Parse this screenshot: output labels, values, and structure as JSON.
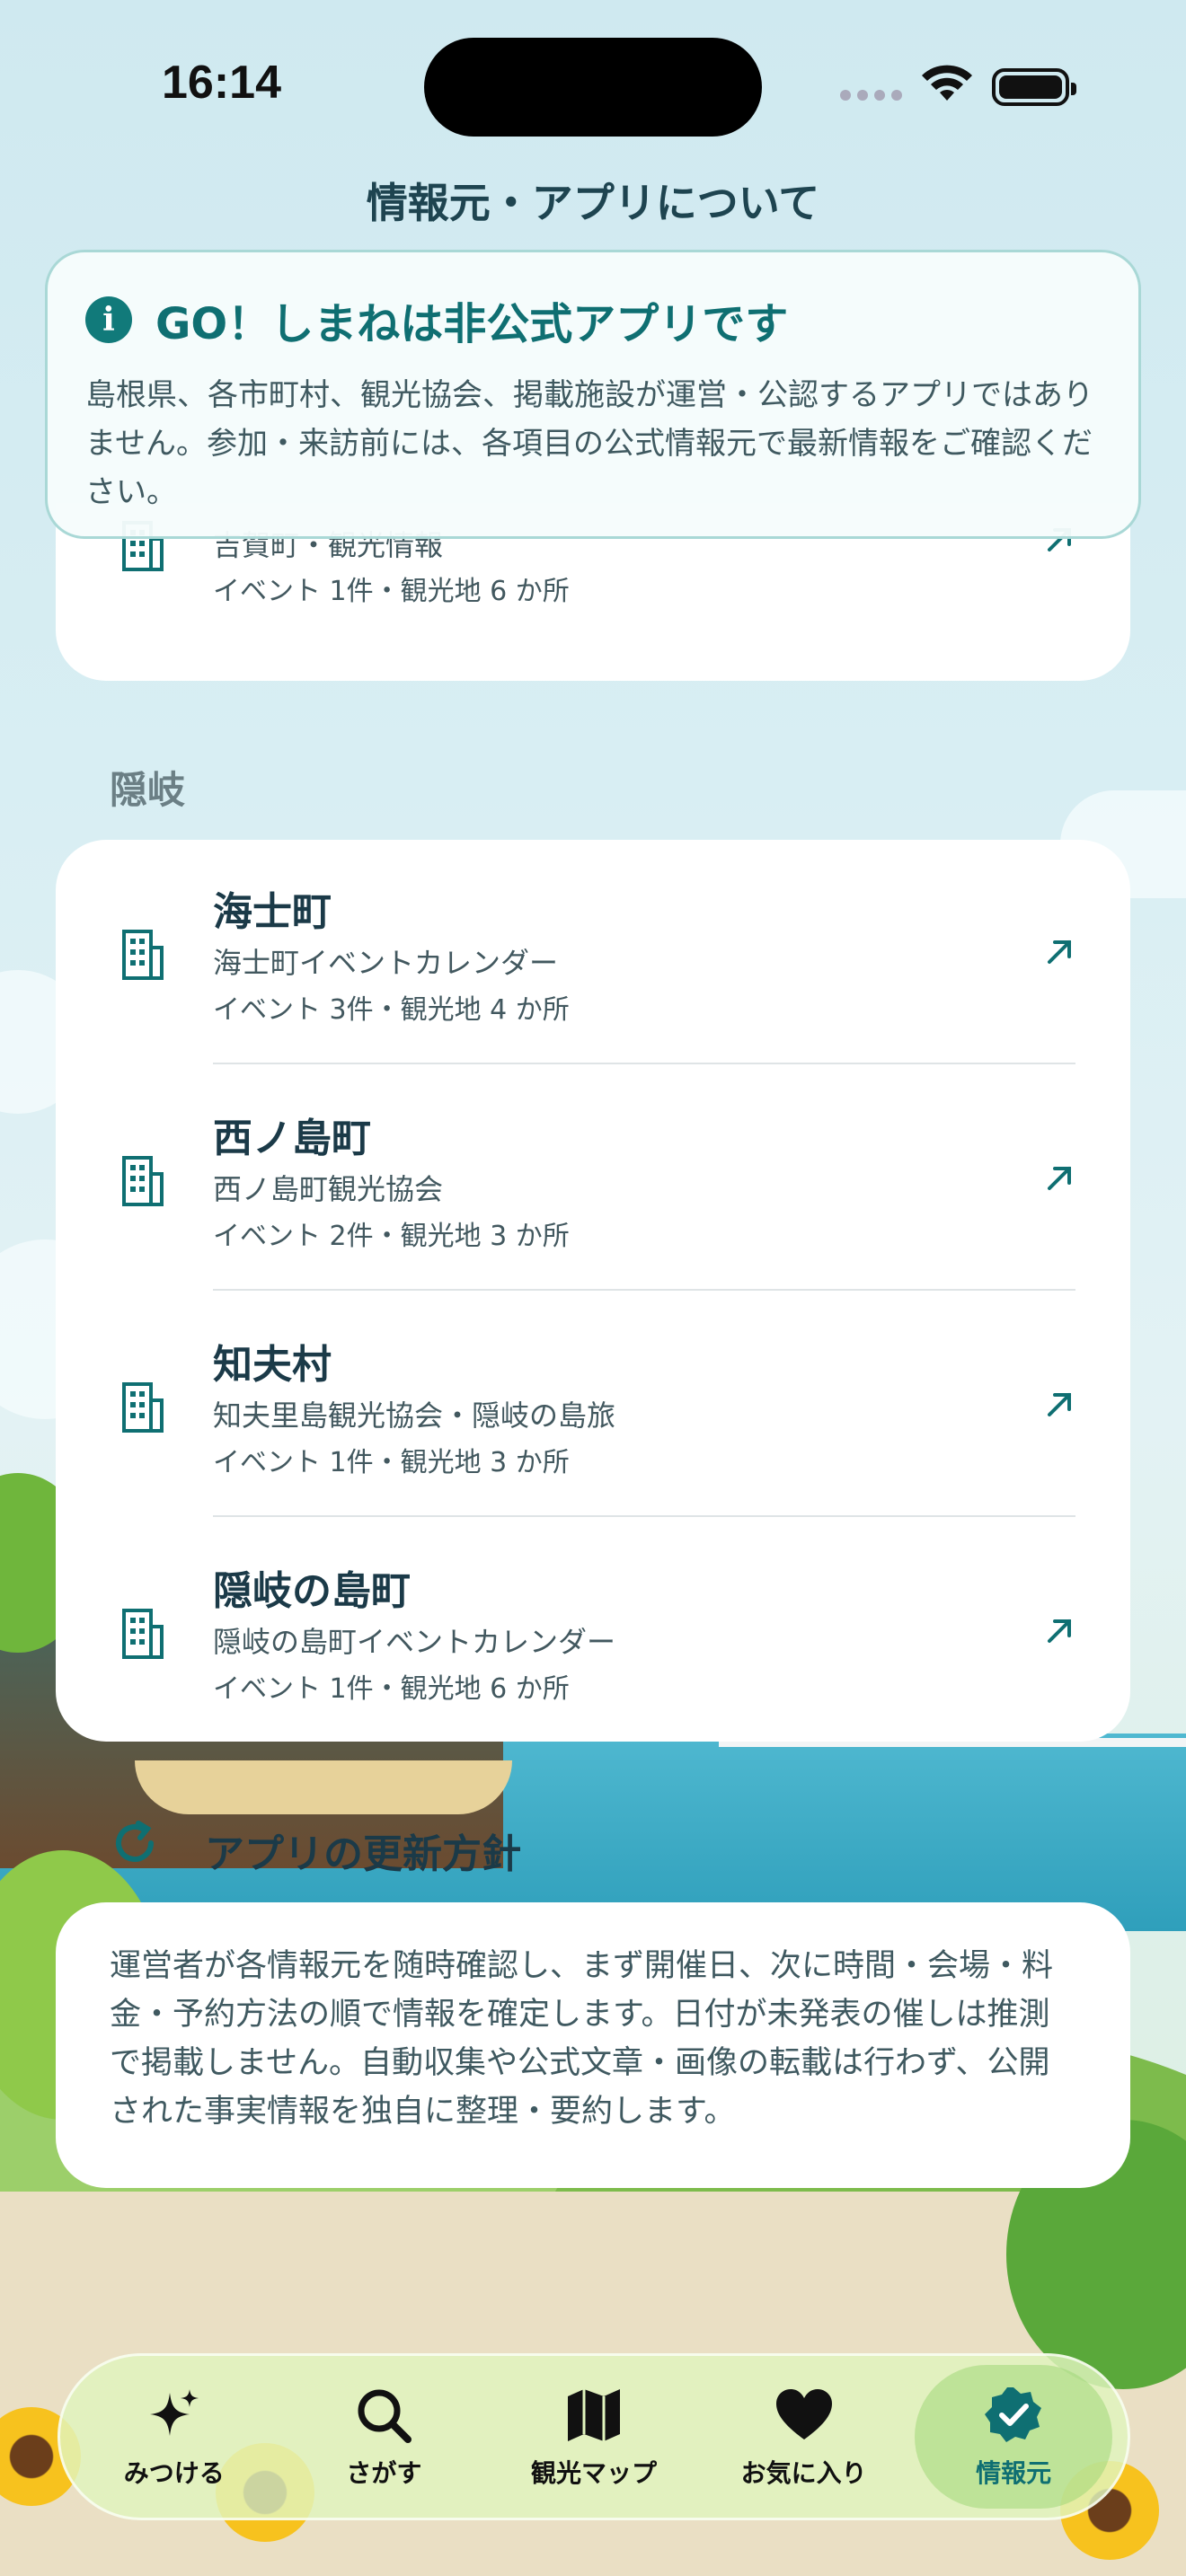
{
  "status_bar": {
    "time": "16:14"
  },
  "page_title": "情報元・アプリについて",
  "notice": {
    "title": "GO！しまねは非公式アプリです",
    "body": "島根県、各市町村、観光協会、掲載施設が運営・公認するアプリではありません。参加・来訪前には、各項目の公式情報元で最新情報をご確認ください。"
  },
  "partial_row": {
    "sub": "吉賀町・観光情報",
    "meta": "イベント 1件・観光地 6 か所"
  },
  "oki": {
    "label": "隠岐",
    "rows": [
      {
        "name": "海士町",
        "sub": "海士町イベントカレンダー",
        "meta": "イベント 3件・観光地 4 か所"
      },
      {
        "name": "西ノ島町",
        "sub": "西ノ島町観光協会",
        "meta": "イベント 2件・観光地 3 か所"
      },
      {
        "name": "知夫村",
        "sub": "知夫里島観光協会・隠岐の島旅",
        "meta": "イベント 1件・観光地 3 か所"
      },
      {
        "name": "隠岐の島町",
        "sub": "隠岐の島町イベントカレンダー",
        "meta": "イベント 1件・観光地 6 か所"
      }
    ]
  },
  "update_policy": {
    "title": "アプリの更新方針",
    "body": "運営者が各情報元を随時確認し、まず開催日、次に時間・会場・料金・予約方法の順で情報を確定します。日付が未発表の催しは推測で掲載しません。自動収集や公式文章・画像の転載は行わず、公開された事実情報を独自に整理・要約します。"
  },
  "tabs": [
    {
      "label": "みつける",
      "icon": "sparkles-icon"
    },
    {
      "label": "さがす",
      "icon": "search-icon"
    },
    {
      "label": "観光マップ",
      "icon": "map-icon"
    },
    {
      "label": "お気に入り",
      "icon": "heart-icon"
    },
    {
      "label": "情報元",
      "icon": "verified-badge-icon",
      "active": true
    }
  ],
  "colors": {
    "accent": "#0f6f72",
    "text": "#1b3a48"
  }
}
